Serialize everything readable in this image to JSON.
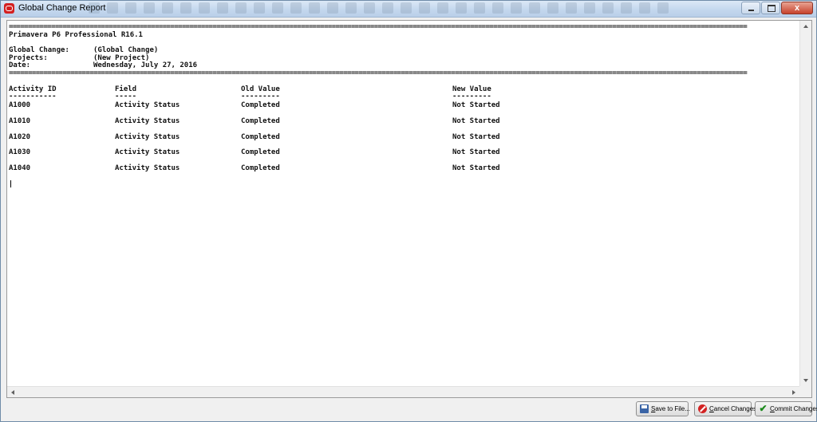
{
  "window": {
    "title": "Global Change Report",
    "app_icon": "oracle-icon",
    "controls": {
      "minimize": "minimize-icon",
      "maximize": "maximize-icon",
      "close_glyph": "x"
    }
  },
  "report": {
    "rule": "================================================================================================================================================================================================",
    "product": "Primavera P6 Professional R16.1",
    "meta": [
      {
        "label": "Global Change:",
        "value": "(Global Change)"
      },
      {
        "label": "Projects:",
        "value": "(New Project)"
      },
      {
        "label": "Date:",
        "value": "Wednesday, July 27, 2016"
      }
    ],
    "columns": [
      "Activity ID",
      "Field",
      "Old Value",
      "New Value"
    ],
    "underlines": [
      "-----------",
      "-----",
      "---------",
      "---------"
    ],
    "rows": [
      [
        "A1000",
        "Activity Status",
        "Completed",
        "Not Started"
      ],
      [
        "A1010",
        "Activity Status",
        "Completed",
        "Not Started"
      ],
      [
        "A1020",
        "Activity Status",
        "Completed",
        "Not Started"
      ],
      [
        "A1030",
        "Activity Status",
        "Completed",
        "Not Started"
      ],
      [
        "A1040",
        "Activity Status",
        "Completed",
        "Not Started"
      ]
    ]
  },
  "footer": {
    "save_mnemonic": "S",
    "save_rest": "ave to File...",
    "cancel_mnemonic": "C",
    "cancel_rest": "ancel Changes",
    "commit_mnemonic": "C",
    "commit_rest": "ommit Changes"
  }
}
